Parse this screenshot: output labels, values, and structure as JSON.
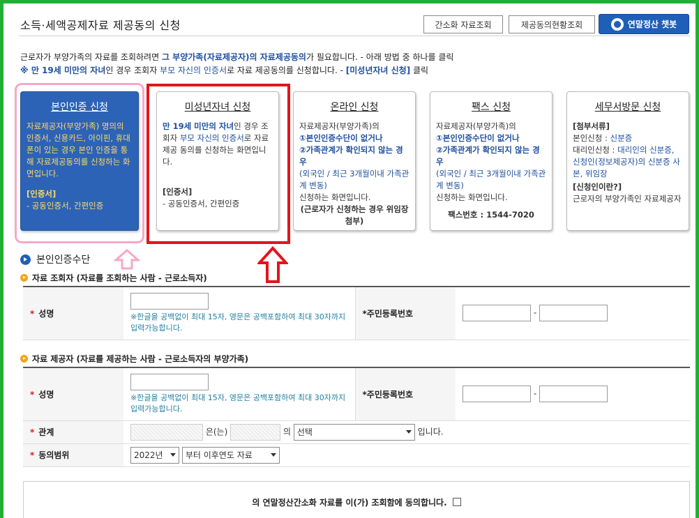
{
  "header": {
    "title": "소득·세액공제자료 제공동의 신청",
    "btn_simple": "간소화 자료조회",
    "btn_status": "제공동의현황조회",
    "btn_chatbot": "연말정산 챗봇"
  },
  "intro": {
    "line1_a": "근로자가 부양가족의 자료를 조회하려면 ",
    "line1_b": "그 부양가족(자료제공자)의 자료제공동의",
    "line1_c": "가 필요합니다. - 아래 방법 중 하나를 클릭",
    "line2_a": "※ 만 19세 미만의 자녀",
    "line2_b": "인 경우 조회자 ",
    "line2_c": "부모 자신의 인증서",
    "line2_d": "로 자료 제공동의를 신청합니다. - ",
    "line2_e": "[미성년자녀 신청]",
    "line2_f": " 클릭"
  },
  "cards": [
    {
      "title": "본인인증 신청",
      "desc": "자료제공자(부양가족) 명의의 인증서, 신용카드, 아이핀, 휴대폰이 있는 경우 본인 인증을 통해 자료제공동의를 신청하는 화면입니다.",
      "sec": "[인증서]",
      "sec_desc": "- 공동인증서, 간편인증"
    },
    {
      "title": "미성년자녀 신청",
      "desc_b": "만 19세 미만의 자녀",
      "desc_a": "인 경우 조회자 ",
      "desc_c": "부모 자신의 인증서",
      "desc_d": "로 자료 제공 동의를 신청하는 화면입니다.",
      "sec": "[인증서]",
      "sec_desc": "- 공동인증서, 간편인증"
    },
    {
      "title": "온라인 신청",
      "l1": "자료제공자(부양가족)의",
      "l2": "①본인인증수단이 없거나",
      "l3": "②가족관계가 확인되지 않는 경우",
      "l4": "(외국인 / 최근 3개월이내 가족관계 변동)",
      "l5": "신청하는 화면입니다.",
      "l6": "(근로자가 신청하는 경우 위임장 첨부)"
    },
    {
      "title": "팩스 신청",
      "l1": "자료제공자(부양가족)의",
      "l2": "①본인인증수단이 없거나",
      "l3": "②가족관계가 확인되지 않는 경우",
      "l4": "(외국인 / 최근 3개월이내 가족관계 변동)",
      "l5": "신청하는 화면입니다.",
      "fax": "팩스번호 : 1544-7020"
    },
    {
      "title": "세무서방문 신청",
      "sec1": "[첨부서류]",
      "s1a": "본인신청 : ",
      "s1b": "신분증",
      "s2a": "대리인신청 : ",
      "s2b": "대리인의 신분증, 신청인(정보제공자)의 신분증 사본, 위임장",
      "sec2": "[신청인이란?]",
      "s3": "근로자의 부양가족인 자료제공자"
    }
  ],
  "section": {
    "title": "본인인증수단",
    "sub1": "자료 조회자 (자료를 조회하는 사람 - 근로소득자)",
    "sub2": "자료 제공자 (자료를 제공하는 사람 - 근로소득자의 부양가족)"
  },
  "form": {
    "req": "*",
    "name_label": "성명",
    "rrn_label": "주민등록번호",
    "name_note": "※한글을 공백없이 최대 15자, 영문은 공백포함하여 최대 30자까지 입력가능합니다.",
    "dash": "-",
    "relation_label": "관계",
    "relation_text1": "은(는)",
    "relation_text2": "의",
    "relation_select": "선택",
    "relation_text3": "입니다.",
    "range_label": "동의범위",
    "year_select": "2022년",
    "range_select": "부터 이후연도 자료"
  },
  "agree": {
    "text": "의 연말정산간소화 자료를 이(가) 조회함에 동의합니다."
  },
  "colors": {
    "border_green": "#20b036",
    "active_blue": "#2c63b6",
    "highlight_red": "#e3141b",
    "highlight_pink": "#f7a7c9"
  }
}
